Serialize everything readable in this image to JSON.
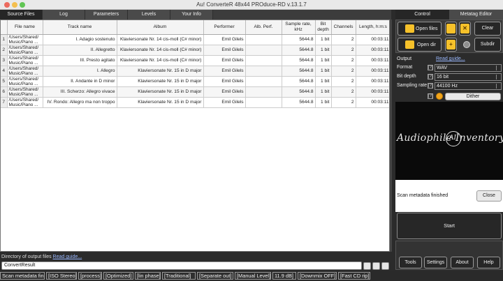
{
  "window": {
    "title": "Au! ConverteR 48x44 PROduce-RD v.13.1.7"
  },
  "left_tabs": [
    "Source Files",
    "Log",
    "Parameters",
    "Levels",
    "Your Info"
  ],
  "table": {
    "columns": [
      "File name",
      "Track name",
      "Album",
      "Performer",
      "Alb. Perf.",
      "Sample rate, kHz",
      "Bit depth",
      "Channels",
      "Length, h:m:s"
    ],
    "rows": [
      {
        "idx": "1",
        "file": "/Users/Shared/ Music/Piano ...",
        "track": "I. Adagio sostenuto",
        "album": "Klaviersonate Nr. 14 cis-moll (C# minor)",
        "performer": "Emil Gilels",
        "alb_perf": "",
        "rate": "5644.8",
        "bits": "1 bit",
        "channels": "2",
        "length": "00:03:11"
      },
      {
        "idx": "2",
        "file": "/Users/Shared/ Music/Piano ...",
        "track": "II. Allegretto",
        "album": "Klaviersonate Nr. 14 cis-moll (C# minor)",
        "performer": "Emil Gilels",
        "alb_perf": "",
        "rate": "5644.8",
        "bits": "1 bit",
        "channels": "2",
        "length": "00:03:11"
      },
      {
        "idx": "3",
        "file": "/Users/Shared/ Music/Piano ...",
        "track": "III. Presto agitato",
        "album": "Klaviersonate Nr. 14 cis-moll (C# minor)",
        "performer": "Emil Gilels",
        "alb_perf": "",
        "rate": "5644.8",
        "bits": "1 bit",
        "channels": "2",
        "length": "00:03:11"
      },
      {
        "idx": "4",
        "file": "/Users/Shared/ Music/Piano ...",
        "track": "I. Allegro",
        "album": "Klaviersonate Nr. 15 in D major",
        "performer": "Emil Gilels",
        "alb_perf": "",
        "rate": "5644.8",
        "bits": "1 bit",
        "channels": "2",
        "length": "00:03:11"
      },
      {
        "idx": "5",
        "file": "/Users/Shared/ Music/Piano ...",
        "track": "II. Andante in D minor",
        "album": "Klaviersonate Nr. 15 in D major",
        "performer": "Emil Gilels",
        "alb_perf": "",
        "rate": "5644.8",
        "bits": "1 bit",
        "channels": "2",
        "length": "00:03:11"
      },
      {
        "idx": "6",
        "file": "/Users/Shared/ Music/Piano ...",
        "track": "III. Scherzo: Allegro vivace",
        "album": "Klaviersonate Nr. 15 in D major",
        "performer": "Emil Gilels",
        "alb_perf": "",
        "rate": "5644.8",
        "bits": "1 bit",
        "channels": "2",
        "length": "00:03:11"
      },
      {
        "idx": "7",
        "file": "/Users/Shared/ Music/Piano ...",
        "track": "IV. Rondo: Allegro ma non troppo",
        "album": "Klaviersonate Nr. 15 in D major",
        "performer": "Emil Gilels",
        "alb_perf": "",
        "rate": "5644.8",
        "bits": "1 bit",
        "channels": "2",
        "length": "00:03:11"
      }
    ]
  },
  "output_dir": {
    "label": "Directory of output files",
    "guide": "Read guide...",
    "value": "ConvertResult"
  },
  "status_bar": [
    "Scan metadata finish",
    "[ISO Stereo]",
    "[process]",
    "[Optimized]",
    "[lin phase]",
    "[Traditional]",
    "[Separate out]",
    "[Manual Level]",
    "11.9 dB]",
    "[Downmix OFF]",
    "[Fast CD rip]"
  ],
  "right_tabs": [
    "Control",
    "Metatag Editor"
  ],
  "controls": {
    "open_files": "Open files",
    "open_dir": "Open dir",
    "clear": "Clear",
    "subdir": "Subdir",
    "x_glyph": "✕",
    "plus_glyph": "+"
  },
  "output": {
    "header": "Output",
    "guide": "Read guide...",
    "help": "[?]",
    "format_label": "Format",
    "format_value": "WAV",
    "bitdepth_label": "Bit depth",
    "bitdepth_value": "16 bit",
    "rate_label": "Sampling rate",
    "rate_value": "44100 Hz",
    "dither_label": "Dither"
  },
  "logo": {
    "text": "Audiophile Inventory",
    "mark": "AI"
  },
  "message": {
    "text": "Scan metadata finished",
    "close": "Close"
  },
  "start_label": "Start",
  "bottom_buttons": [
    "Tools",
    "Settings",
    "About",
    "Help"
  ]
}
